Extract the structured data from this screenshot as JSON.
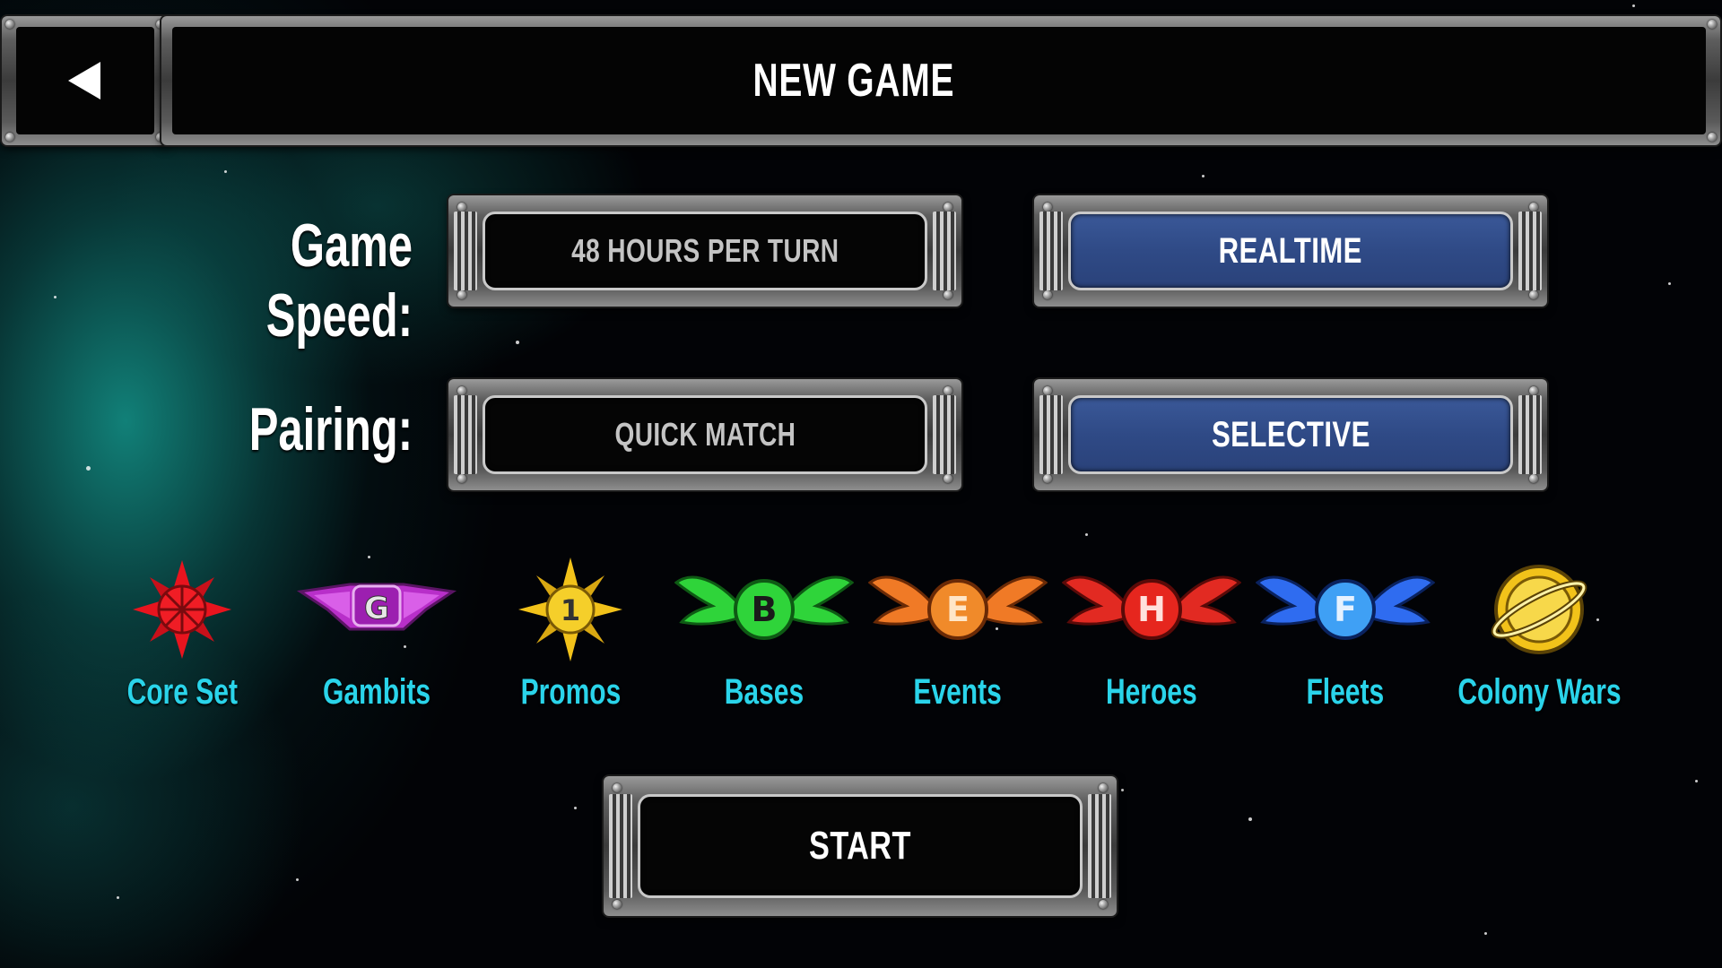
{
  "header": {
    "back_icon": "back-arrow-icon",
    "title": "NEW GAME"
  },
  "game_speed": {
    "label": "Game Speed:",
    "options": [
      {
        "label": "48 HOURS PER TURN",
        "selected": false
      },
      {
        "label": "REALTIME",
        "selected": true
      }
    ]
  },
  "pairing": {
    "label": "Pairing:",
    "options": [
      {
        "label": "QUICK MATCH",
        "selected": false
      },
      {
        "label": "SELECTIVE",
        "selected": true
      }
    ]
  },
  "expansions": [
    {
      "label": "Core Set",
      "icon": "core-set-icon",
      "color": "#e8141e"
    },
    {
      "label": "Gambits",
      "icon": "gambits-icon",
      "glyph": "G",
      "color": "#b82fc9"
    },
    {
      "label": "Promos",
      "icon": "promos-icon",
      "glyph": "1",
      "color": "#f2c21a"
    },
    {
      "label": "Bases",
      "icon": "bases-icon",
      "glyph": "B",
      "color": "#2fd43a"
    },
    {
      "label": "Events",
      "icon": "events-icon",
      "glyph": "E",
      "color": "#f07a26"
    },
    {
      "label": "Heroes",
      "icon": "heroes-icon",
      "glyph": "H",
      "color": "#e22a22"
    },
    {
      "label": "Fleets",
      "icon": "fleets-icon",
      "glyph": "F",
      "color": "#2f6cf0"
    },
    {
      "label": "Colony Wars",
      "icon": "colony-wars-icon",
      "color": "#f2c21a"
    }
  ],
  "start": {
    "label": "START"
  },
  "colors": {
    "selected_fill": "#2f4a86",
    "expansion_label": "#2ad4ea"
  }
}
